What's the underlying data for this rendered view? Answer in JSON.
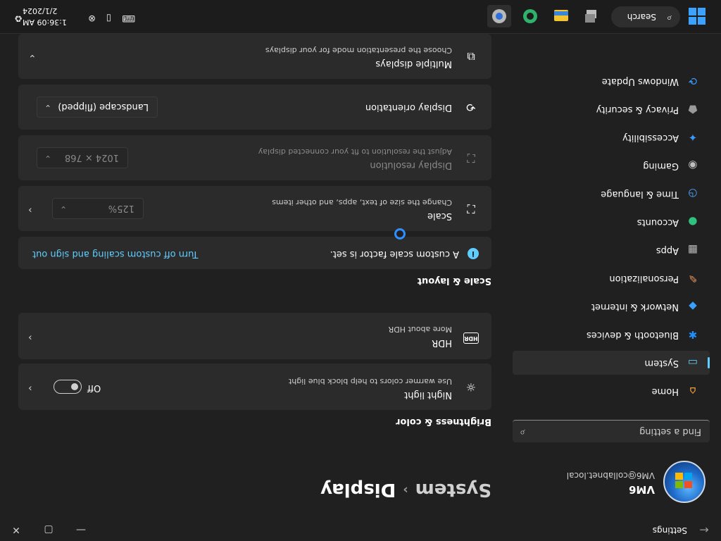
{
  "titlebar": {
    "app_title": "Settings",
    "back_glyph": "←",
    "minimize_glyph": "—",
    "maximize_glyph": "▢",
    "close_glyph": "✕"
  },
  "profile": {
    "name": "VM6",
    "email": "VM6@collabnet.local"
  },
  "search": {
    "placeholder": "Find a setting",
    "icon": "search-icon"
  },
  "nav": {
    "items": [
      {
        "label": "Home",
        "icon": "home-icon",
        "glyph": "⌂",
        "color": "#f0a040"
      },
      {
        "label": "System",
        "icon": "system-icon",
        "glyph": "▭",
        "color": "#60cdff",
        "selected": true
      },
      {
        "label": "Bluetooth & devices",
        "icon": "bluetooth-icon",
        "glyph": "✱",
        "color": "#1e90ff"
      },
      {
        "label": "Network & internet",
        "icon": "network-icon",
        "glyph": "◆",
        "color": "#3aa0ff"
      },
      {
        "label": "Personalization",
        "icon": "brush-icon",
        "glyph": "✎",
        "color": "#e8965a"
      },
      {
        "label": "Apps",
        "icon": "apps-icon",
        "glyph": "▦",
        "color": "#b8b8b8"
      },
      {
        "label": "Accounts",
        "icon": "accounts-icon",
        "glyph": "●",
        "color": "#2ec27e"
      },
      {
        "label": "Time & language",
        "icon": "time-language-icon",
        "glyph": "◷",
        "color": "#4aa3ff"
      },
      {
        "label": "Gaming",
        "icon": "gaming-icon",
        "glyph": "◉",
        "color": "#c0c0c0"
      },
      {
        "label": "Accessibility",
        "icon": "accessibility-icon",
        "glyph": "✦",
        "color": "#3a9bff"
      },
      {
        "label": "Privacy & security",
        "icon": "shield-icon",
        "glyph": "⬟",
        "color": "#9a9a9a"
      },
      {
        "label": "Windows Update",
        "icon": "windows-update-icon",
        "glyph": "⟳",
        "color": "#3a9bff"
      }
    ]
  },
  "breadcrumb": {
    "parent": "System",
    "separator": "›",
    "current": "Display"
  },
  "brightness_section": {
    "heading": "Brightness & color",
    "night_light": {
      "title": "Night light",
      "subtitle": "Use warmer colors to help block blue light",
      "state": "Off",
      "icon": "sun-icon",
      "glyph": "☼"
    },
    "hdr": {
      "title": "HDR",
      "link": "More about HDR",
      "icon": "hdr-icon",
      "glyph": "HDR"
    }
  },
  "scale_section": {
    "heading": "Scale & layout",
    "notice": {
      "text": "A custom scale factor is set.",
      "action": "Turn off custom scaling and sign out",
      "icon": "info-icon",
      "glyph": "i"
    },
    "scale": {
      "title": "Scale",
      "subtitle": "Change the size of text, apps, and other items",
      "value": "125%",
      "icon": "scale-icon",
      "glyph": "⛶"
    },
    "resolution": {
      "title": "Display resolution",
      "subtitle": "Adjust the resolution to fit your connected display",
      "value": "1024 × 768",
      "icon": "resolution-icon",
      "glyph": "⛶"
    },
    "orientation": {
      "title": "Display orientation",
      "value": "Landscape (flipped)",
      "icon": "orientation-icon",
      "glyph": "⟲"
    },
    "multiple": {
      "title": "Multiple displays",
      "subtitle": "Choose the presentation mode for your displays",
      "icon": "multiple-displays-icon",
      "glyph": "⧉"
    }
  },
  "taskbar": {
    "search_label": "Search",
    "apps": [
      {
        "name": "task-view-icon",
        "active": false
      },
      {
        "name": "file-explorer-icon",
        "active": false
      },
      {
        "name": "green-app-icon",
        "active": false
      },
      {
        "name": "settings-gear-icon",
        "active": true
      }
    ],
    "clock_time": "1:36:09 AM",
    "clock_date": "2/1/2024"
  },
  "colors": {
    "accent": "#60cdff",
    "background": "#202020",
    "card": "#2b2b2b"
  }
}
